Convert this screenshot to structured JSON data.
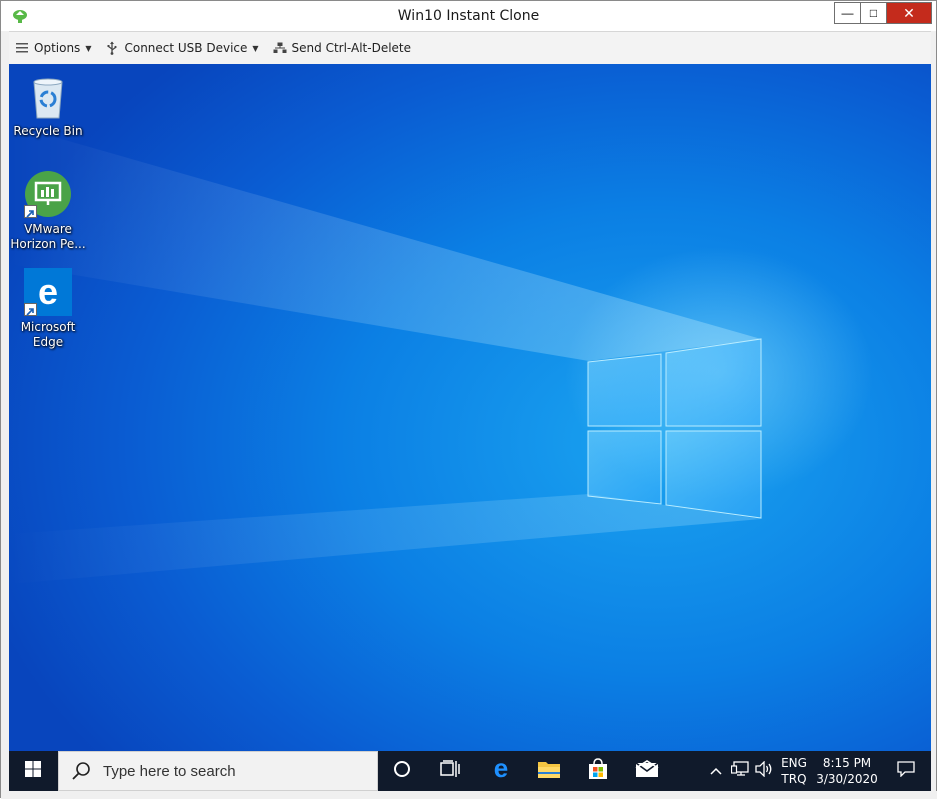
{
  "window": {
    "title": "Win10 Instant Clone",
    "controls": {
      "minimize": "—",
      "maximize": "□",
      "close": "✕"
    }
  },
  "toolbar": {
    "options_label": "Options",
    "usb_label": "Connect USB Device",
    "ctrl_alt_del_label": "Send Ctrl-Alt-Delete"
  },
  "desktop": {
    "icons": [
      {
        "label_line1": "Recycle Bin",
        "label_line2": "",
        "icon": "recycle-bin-icon"
      },
      {
        "label_line1": "VMware",
        "label_line2": "Horizon Pe...",
        "icon": "vmware-horizon-icon"
      },
      {
        "label_line1": "Microsoft",
        "label_line2": "Edge",
        "icon": "edge-icon"
      }
    ]
  },
  "taskbar": {
    "search_placeholder": "Type here to search",
    "language_line1": "ENG",
    "language_line2": "TRQ",
    "time": "8:15 PM",
    "date": "3/30/2020"
  },
  "colors": {
    "taskbar_bg": "#101a2b",
    "desktop_blue": "#0b7fe4",
    "close_red": "#c42b1c",
    "edge_blue": "#0078d7"
  }
}
